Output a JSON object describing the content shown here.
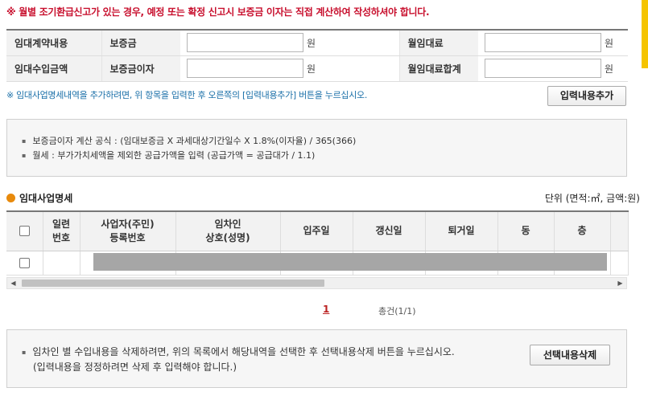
{
  "warning": "※ 월별 조기환급신고가 있는 경우, 예정 또는 확정 신고시 보증금 이자는 직접 계산하여 작성하셔야 합니다.",
  "form": {
    "row1": {
      "label": "임대계약내용",
      "sub1": "보증금",
      "unit1": "원",
      "sub2": "월임대료",
      "unit2": "원"
    },
    "row2": {
      "label": "임대수입금액",
      "sub1": "보증금이자",
      "unit1": "원",
      "sub2": "월임대료합계",
      "unit2": "원"
    },
    "values": {
      "deposit": "",
      "monthly_rent": "",
      "deposit_interest": "",
      "monthly_rent_total": ""
    }
  },
  "info_line": "※ 임대사업명세내역을 추가하려면, 위 항목을 입력한 후 오른쪽의 [입력내용추가] 버튼을 누르십시오.",
  "add_button": "입력내용추가",
  "formula": [
    "보증금이자 계산 공식 : (임대보증금 X 과세대상기간일수 X 1.8%(이자율) / 365(366)",
    "월세 : 부가가치세액을 제외한 공급가액을 입력 (공급가액 = 공급대가 / 1.1)"
  ],
  "section_title": "임대사업명세",
  "unit_note": "단위 (면적:㎡, 금액:원)",
  "grid": {
    "headers": {
      "seq": [
        "일련",
        "번호"
      ],
      "bizno": [
        "사업자(주민)",
        "등록번호"
      ],
      "tenant": [
        "임차인",
        "상호(성명)"
      ],
      "move_in": "입주일",
      "renew": "갱신일",
      "move_out": "퇴거일",
      "dong": "동",
      "floor": "층"
    }
  },
  "pager": {
    "page": "1",
    "total": "총건(1/1)"
  },
  "bottom": {
    "line1": "임차인 별 수입내용을 삭제하려면, 위의 목록에서 해당내역을 선택한 후 선택내용삭제 버튼을 누르십시오.",
    "line2": "(입력내용을 정정하려면 삭제 후 입력해야 합니다.)",
    "delete_button": "선택내용삭제"
  }
}
